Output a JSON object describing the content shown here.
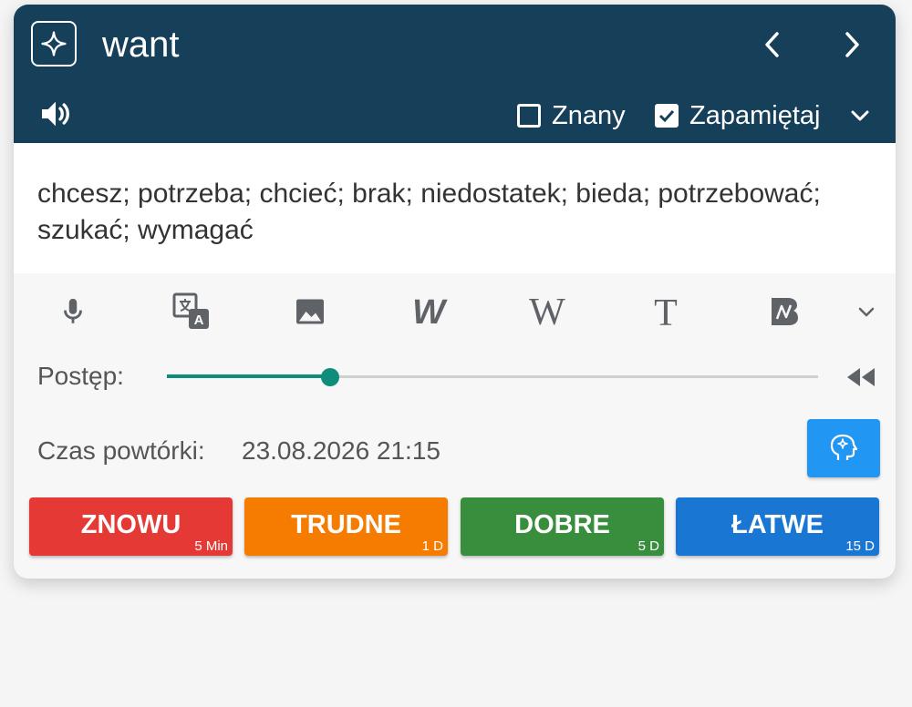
{
  "header": {
    "word": "want",
    "checkboxes": [
      {
        "label": "Znany",
        "checked": false
      },
      {
        "label": "Zapamiętaj",
        "checked": true
      }
    ]
  },
  "translation": "chcesz; potrzeba; chcieć; brak; niedostatek; bieda; potrzebować; szukać; wymagać",
  "toolbar_icons": [
    "microphone-icon",
    "translate-icon",
    "image-icon",
    "w-logo-icon",
    "wikipedia-icon",
    "text-icon",
    "b-logo-icon",
    "chevron-down-icon"
  ],
  "progress": {
    "label": "Postęp:",
    "value": 0.25
  },
  "review": {
    "label": "Czas powtórki:",
    "date": "23.08.2026 21:15"
  },
  "answers": [
    {
      "label": "ZNOWU",
      "interval": "5 Min",
      "color": "#e53935"
    },
    {
      "label": "TRUDNE",
      "interval": "1 D",
      "color": "#f57c00"
    },
    {
      "label": "DOBRE",
      "interval": "5 D",
      "color": "#388e3c"
    },
    {
      "label": "ŁATWE",
      "interval": "15 D",
      "color": "#1976d2"
    }
  ],
  "colors": {
    "header": "#163f59",
    "accent": "#0e8d7b",
    "brain_button": "#2196f3"
  }
}
